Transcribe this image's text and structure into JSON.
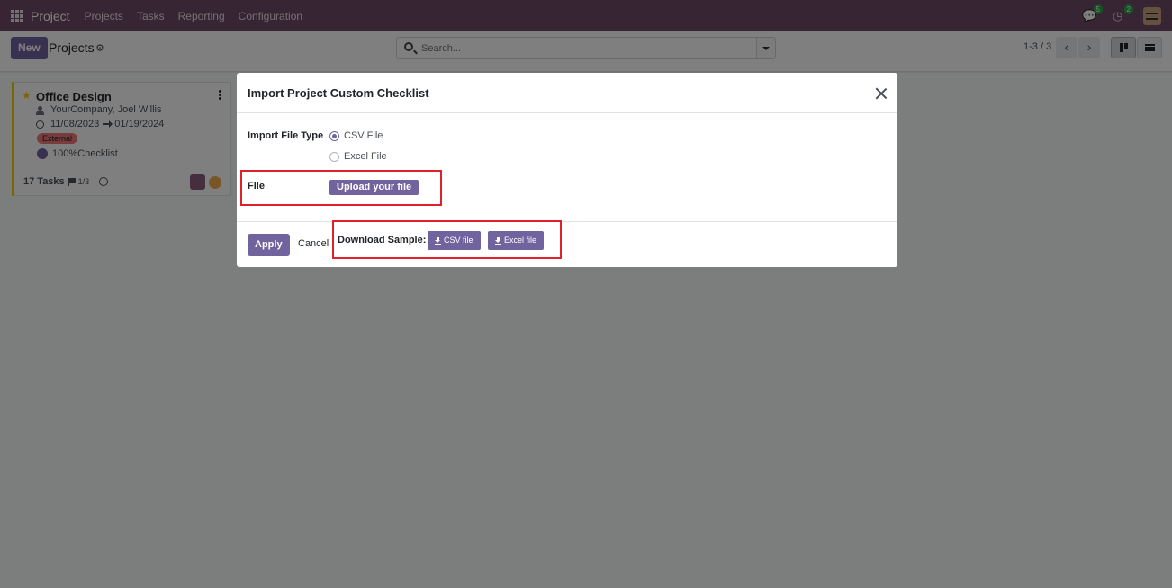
{
  "navbar": {
    "app_name": "Project",
    "menu": [
      "Projects",
      "Tasks",
      "Reporting",
      "Configuration"
    ],
    "messages_count": "5",
    "activities_count": "2",
    "bg_color": "#714b67"
  },
  "control_panel": {
    "new_label": "New",
    "breadcrumb": "Projects",
    "search_placeholder": "Search...",
    "pager_value": "1-3 / 3"
  },
  "kanban": {
    "card": {
      "title": "Office Design",
      "customer": "YourCompany, Joel Willis",
      "date_start": "11/08/2023",
      "date_end": "01/19/2024",
      "tag": "External",
      "checklist": "100%Checklist",
      "tasks": "17 Tasks",
      "milestones": "1/3"
    }
  },
  "modal": {
    "title": "Import Project Custom Checklist",
    "file_type_label": "Import File Type",
    "options": [
      {
        "label": "CSV File",
        "checked": true
      },
      {
        "label": "Excel File",
        "checked": false
      }
    ],
    "file_label": "File",
    "upload_label": "Upload your file",
    "apply_label": "Apply",
    "cancel_label": "Cancel",
    "download_label": "Download Sample:",
    "download_csv_label": "CSV file",
    "download_excel_label": "Excel file"
  },
  "colors": {
    "primary": "#71639e",
    "highlight": "#e0202a",
    "tag": "#f07878"
  }
}
